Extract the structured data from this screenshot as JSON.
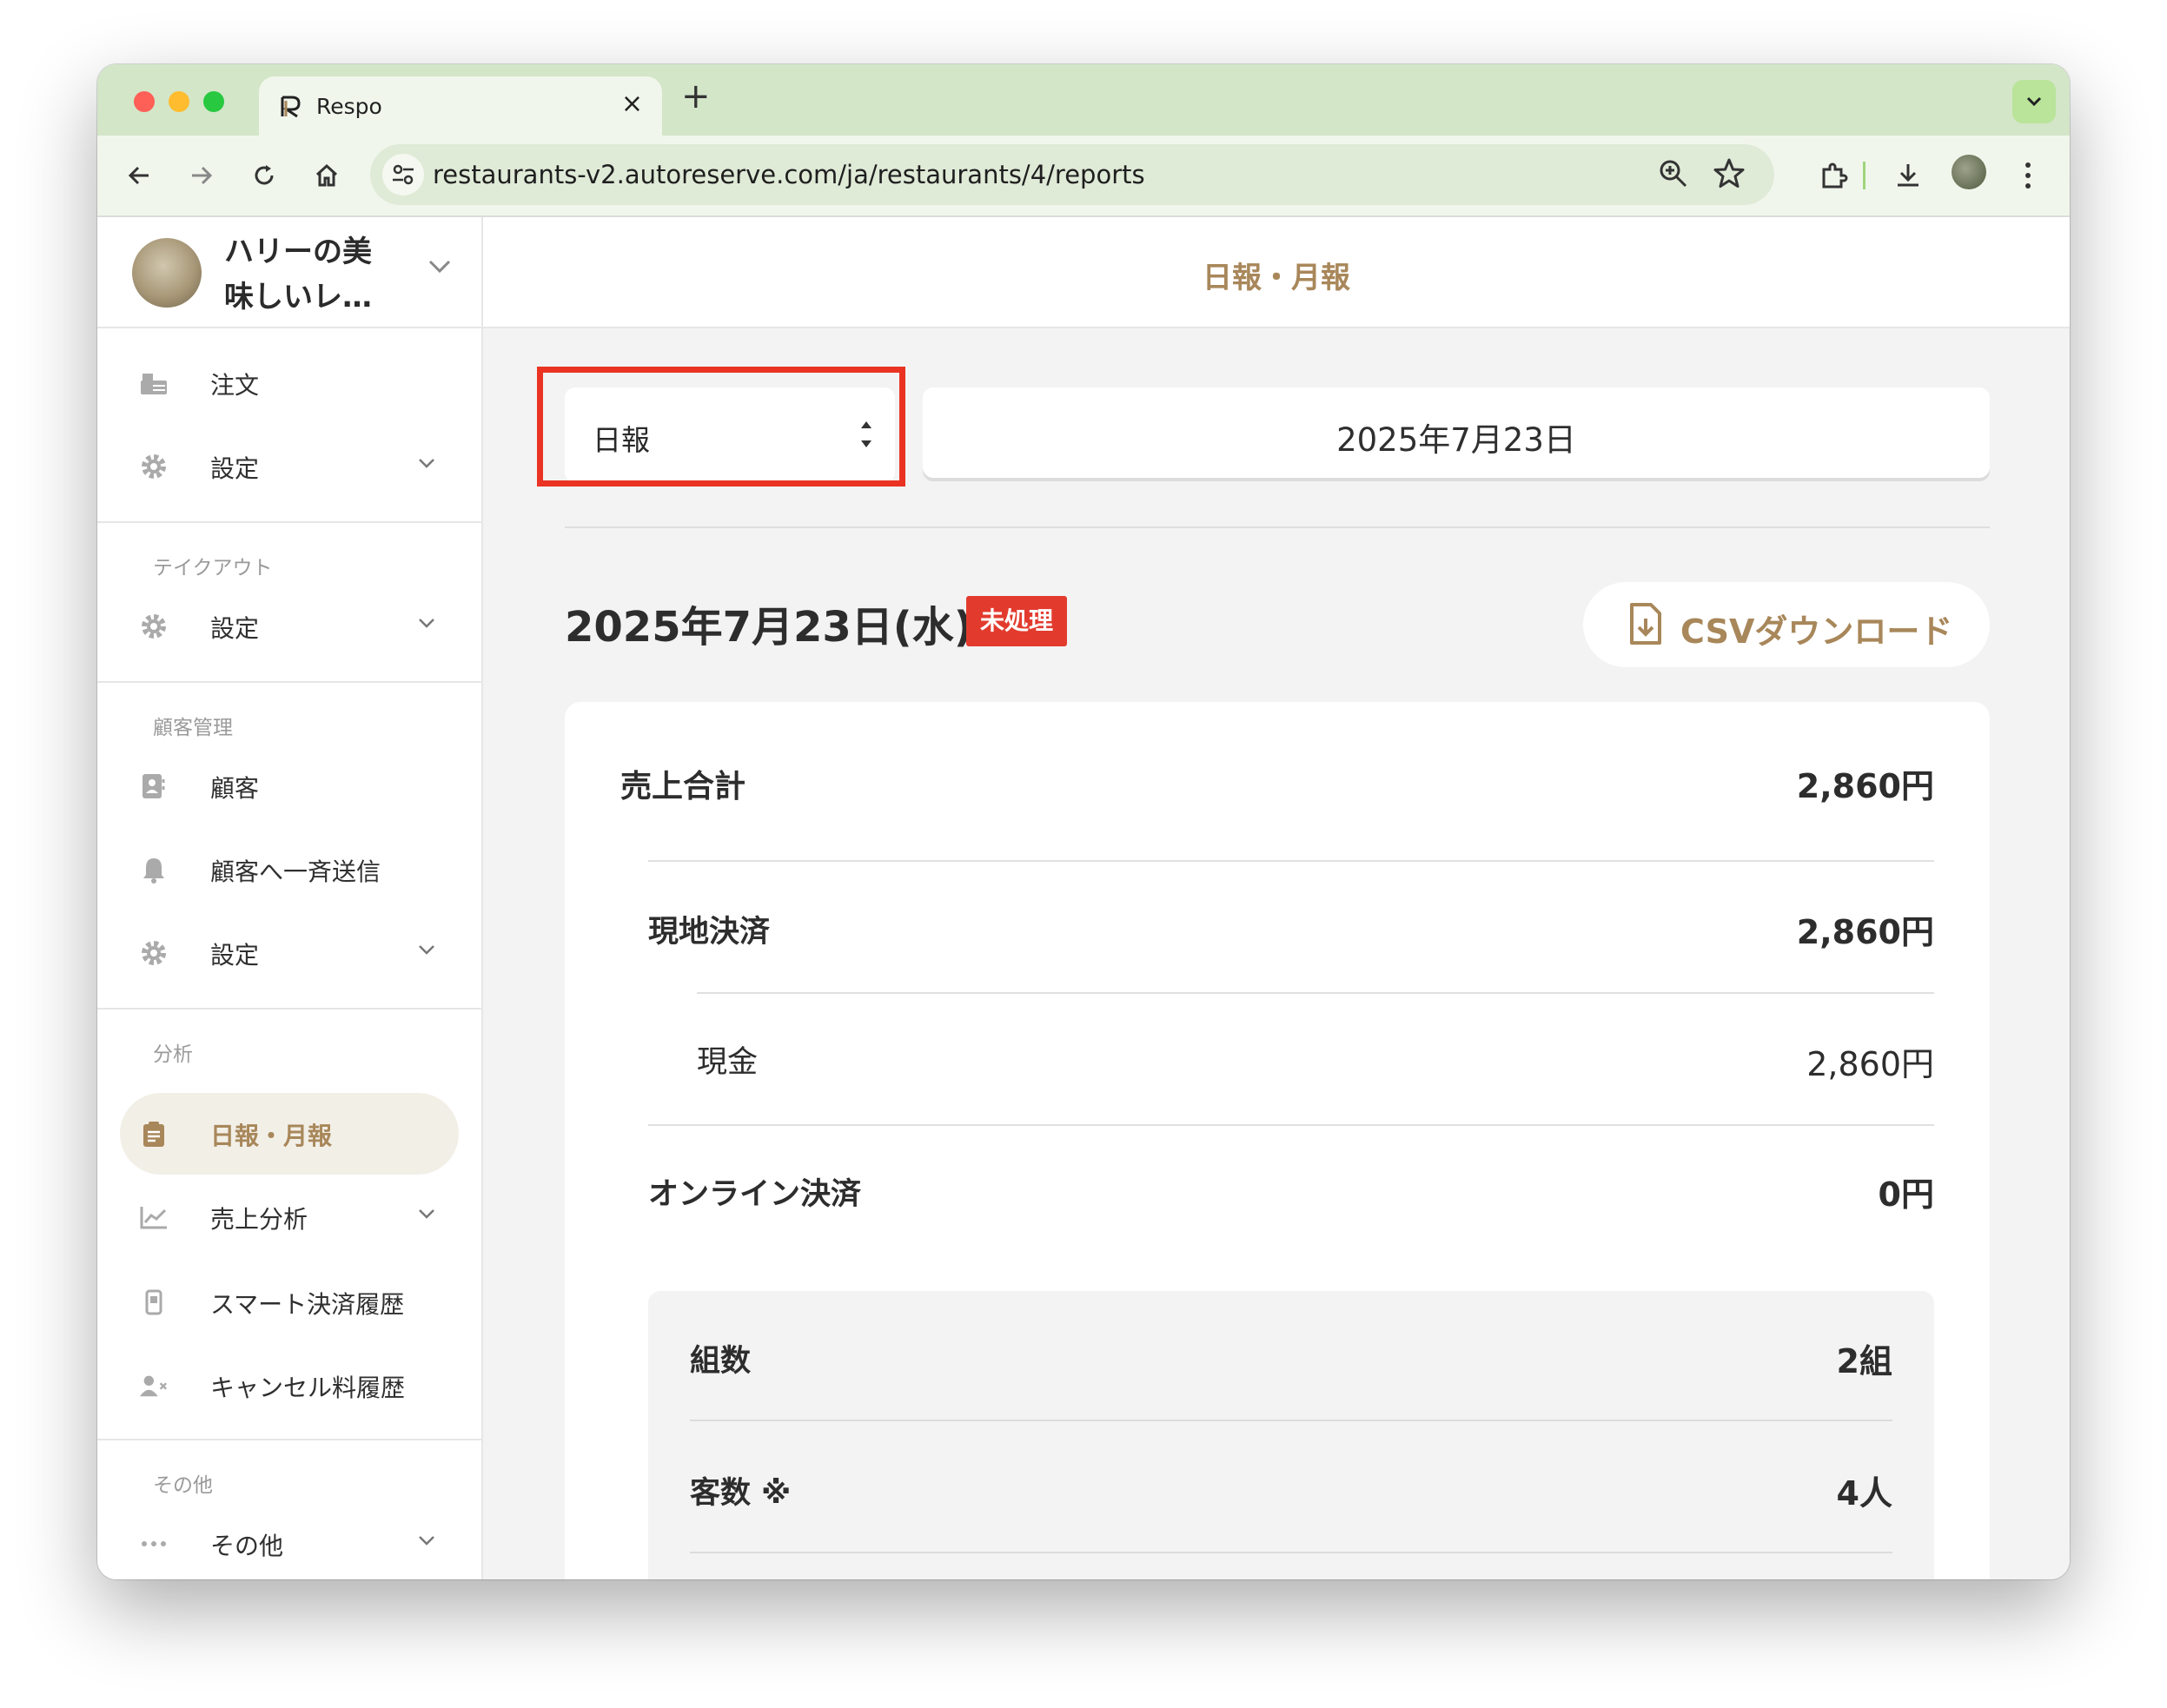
{
  "browser": {
    "tab_title": "Respo",
    "url": "restaurants-v2.autoreserve.com/ja/restaurants/4/reports"
  },
  "sidebar": {
    "shop_name": "ハリーの美味しいレ…",
    "items": {
      "orders": "注文",
      "settings": "設定",
      "takeout_section": "テイクアウト",
      "takeout_settings": "設定",
      "crm_section": "顧客管理",
      "customers": "顧客",
      "broadcast": "顧客へ一斉送信",
      "crm_settings": "設定",
      "analysis_section": "分析",
      "reports": "日報・月報",
      "sales_analysis": "売上分析",
      "smart_payment_history": "スマート決済履歴",
      "cancel_fee_history": "キャンセル料履歴",
      "other_section": "その他",
      "other": "その他"
    }
  },
  "main": {
    "header_title": "日報・月報",
    "period_select": "日報",
    "date_picker": "2025年7月23日",
    "report_date": "2025年7月23日(水)",
    "status_badge": "未処理",
    "csv_button": "CSVダウンロード",
    "rows": {
      "total_sales_label": "売上合計",
      "total_sales_value": "2,860円",
      "onsite_label": "現地決済",
      "onsite_value": "2,860円",
      "cash_label": "現金",
      "cash_value": "2,860円",
      "online_label": "オンライン決済",
      "online_value": "0円",
      "groups_label": "組数",
      "groups_value": "2組",
      "guests_label": "客数 ※",
      "guests_value": "4人"
    }
  },
  "colors": {
    "accent": "#a8875a",
    "highlight_border": "#ea3323",
    "badge": "#e23b2e",
    "tabstrip": "#d3e6c8"
  }
}
